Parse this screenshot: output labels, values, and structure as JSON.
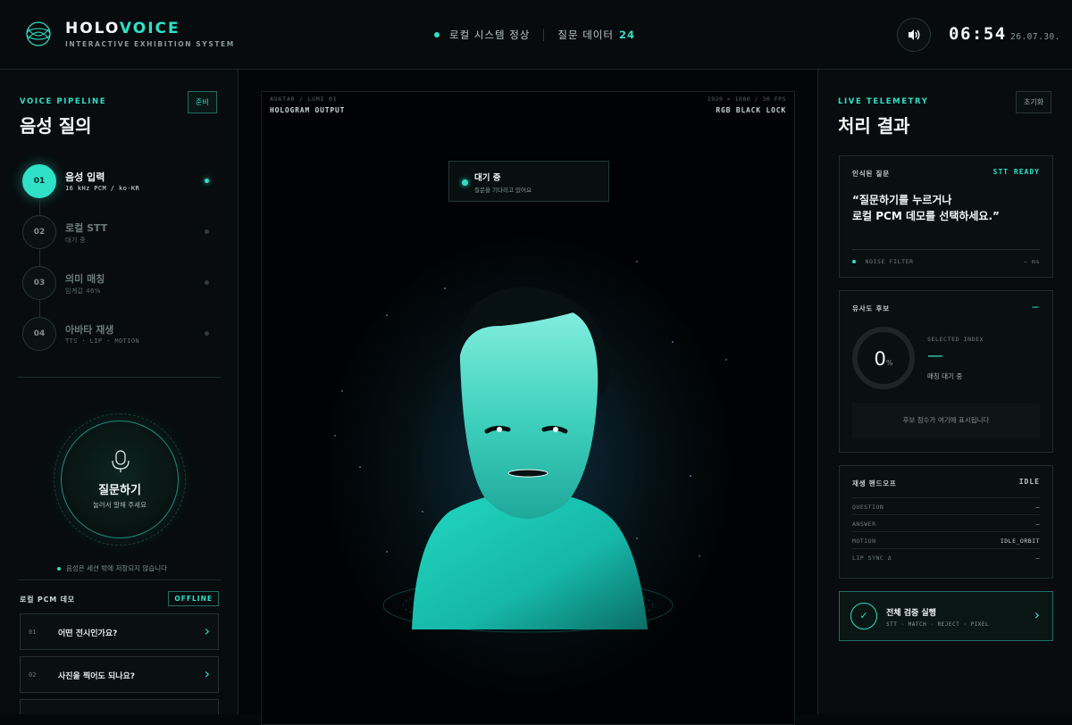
{
  "header": {
    "brand_part1": "HOLO",
    "brand_part2": "VOICE",
    "brand_sub": "INTERACTIVE EXHIBITION SYSTEM",
    "system_status": "로컬 시스템 정상",
    "question_data_label": "질문 데이터",
    "question_data_count": "24",
    "sound_icon": "speaker-icon",
    "time": "06:54",
    "date": "26.07.30."
  },
  "pipeline": {
    "kicker": "VOICE PIPELINE",
    "title": "음성 질의",
    "state_chip": "준비",
    "steps": [
      {
        "num": "01",
        "label": "음성 입력",
        "sub": "16 kHz PCM / ko-KR",
        "active": true
      },
      {
        "num": "02",
        "label": "로컬 STT",
        "sub": "대기 중",
        "active": false
      },
      {
        "num": "03",
        "label": "의미 매칭",
        "sub": "임계값 46%",
        "active": false
      },
      {
        "num": "04",
        "label": "아바타 재생",
        "sub": "TTS · LIP · MOTION",
        "active": false
      }
    ]
  },
  "ask": {
    "label": "질문하기",
    "sub": "눌러서 말해 주세요",
    "icon": "microphone-icon",
    "privacy": "음성은 세션 밖에 저장되지 않습니다"
  },
  "demo": {
    "title": "로컬 PCM 데모",
    "badge": "OFFLINE",
    "items": [
      {
        "num": "01",
        "text": "어떤 전시인가요?"
      },
      {
        "num": "02",
        "text": "사진을 찍어도 되나요?"
      }
    ]
  },
  "stage": {
    "top_left_small": "AVATAR / LUMI 01",
    "top_left": "HOLOGRAM OUTPUT",
    "top_right_small": "1920 × 1080 / 30 FPS",
    "top_right": "RGB BLACK LOCK",
    "wait_title": "대기 중",
    "wait_sub": "질문을 기다리고 있어요"
  },
  "telemetry": {
    "kicker": "LIVE TELEMETRY",
    "title": "처리 결과",
    "reset": "초기화",
    "recognized_label": "인식된 질문",
    "stt_status": "STT READY",
    "quote_line1": "“질문하기를 누르거나",
    "quote_line2": "로컬 PCM 데모를 선택하세요.”",
    "noise_label": "NOISE FILTER",
    "noise_value": "— ms",
    "similarity_label": "유사도 후보",
    "similarity_status": "—",
    "gauge_value": "0",
    "gauge_unit": "%",
    "selected_index_label": "SELECTED INDEX",
    "selected_index_value": "—",
    "selected_index_sub": "매칭 대기 중",
    "candidate_placeholder": "후보 점수가 여기에 표시됩니다",
    "handoff_label": "재생 핸드오프",
    "handoff_status": "IDLE",
    "handoff_rows": [
      {
        "key": "QUESTION",
        "value": "—"
      },
      {
        "key": "ANSWER",
        "value": "—"
      },
      {
        "key": "MOTION",
        "value": "IDLE_ORBIT"
      },
      {
        "key": "LIP SYNC Δ",
        "value": "—"
      }
    ],
    "verify_title": "전체 검증 실행",
    "verify_sub": "STT · MATCH · REJECT · PIXEL"
  }
}
